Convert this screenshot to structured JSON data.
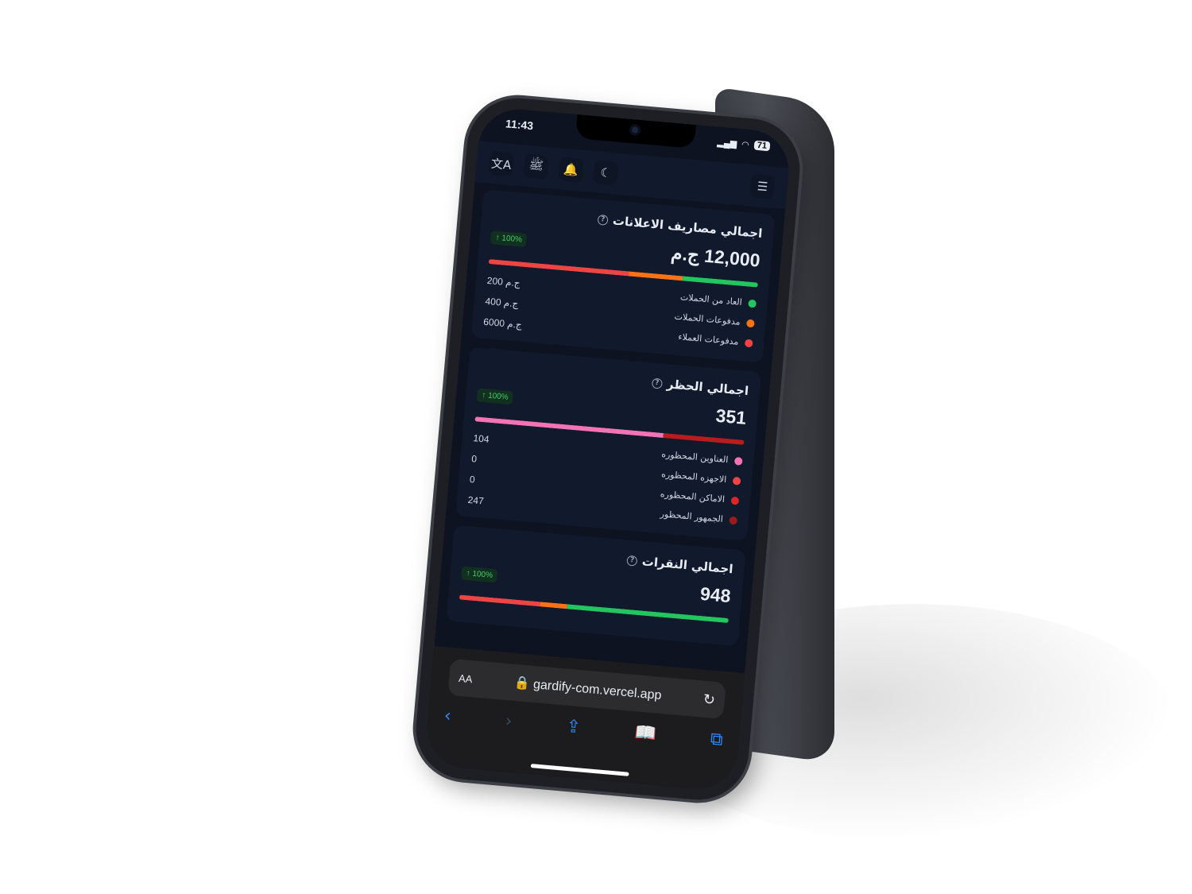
{
  "status": {
    "time": "11:43",
    "battery": "71"
  },
  "topbar": {
    "icons": [
      "translate-icon",
      "currency-icon",
      "bell-icon",
      "moon-icon",
      "menu-icon"
    ],
    "translate_glyph": "文A",
    "currency_glyph": "ﷺ",
    "bell_glyph": "🔔",
    "moon_glyph": "☾",
    "menu_glyph": "☰"
  },
  "cards": [
    {
      "title": "اجمالي مصاريف الاعلانات",
      "help": "?",
      "badge": "↑ 100%",
      "total": "12,000 ج.م",
      "segments": [
        {
          "color": "#ef4444",
          "share": 0.52
        },
        {
          "color": "#f97316",
          "share": 0.2
        },
        {
          "color": "#22c55e",
          "share": 0.28
        }
      ],
      "legend": [
        {
          "label": "العاد من الحملات",
          "color": "#22c55e"
        },
        {
          "label": "مدفوعات الحملات",
          "color": "#f97316"
        },
        {
          "label": "مدفوعات العملاء",
          "color": "#ef4444"
        }
      ],
      "values": [
        "200 ج.م",
        "400 ج.م",
        "6000 ج.م"
      ]
    },
    {
      "title": "اجمالي الحظر",
      "help": "?",
      "badge": "↑ 100%",
      "total": "351",
      "segments": [
        {
          "color": "#f472b6",
          "share": 0.7
        },
        {
          "color": "#b91c1c",
          "share": 0.3
        }
      ],
      "legend": [
        {
          "label": "العناوين المحظوره",
          "color": "#f472b6"
        },
        {
          "label": "الاجهزه المحظوره",
          "color": "#ef4444"
        },
        {
          "label": "الاماكن المحظوره",
          "color": "#dc2626"
        },
        {
          "label": "الجمهور المحظور",
          "color": "#991b1b"
        }
      ],
      "values": [
        "104",
        "0",
        "0",
        "247"
      ]
    },
    {
      "title": "اجمالي النقرات",
      "help": "?",
      "badge": "↑ 100%",
      "total": "948",
      "segments": [
        {
          "color": "#ef4444",
          "share": 0.3
        },
        {
          "color": "#f97316",
          "share": 0.1
        },
        {
          "color": "#22c55e",
          "share": 0.6
        }
      ],
      "legend": [],
      "values": []
    }
  ],
  "safari": {
    "text_size_label": "AA",
    "url": "🔒 gardify-com.vercel.app",
    "reload": "↻",
    "nav": {
      "back": "‹",
      "forward": "›",
      "share": "⇪",
      "bookmarks": "📖",
      "tabs": "⧉"
    }
  }
}
